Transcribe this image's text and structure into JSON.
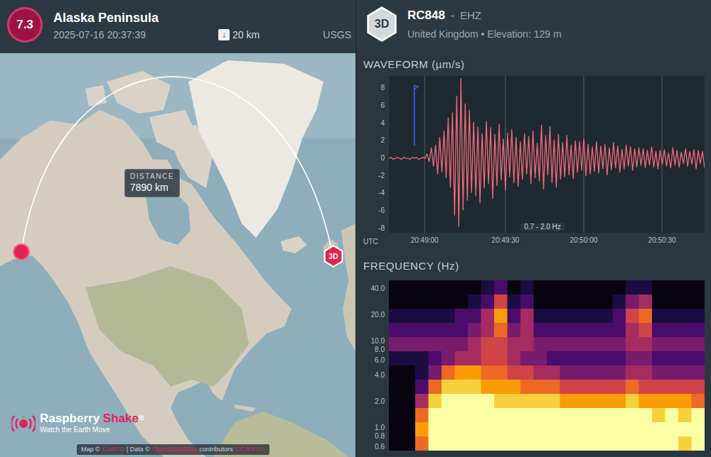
{
  "event": {
    "magnitude": "7.3",
    "region": "Alaska Peninsula",
    "time": "2025-07-16 20:37:39",
    "depth_icon": "↓",
    "depth": "20 km",
    "source": "USGS"
  },
  "map": {
    "distance_label": "DISTANCE",
    "distance": "7890 km",
    "station_marker": "3D",
    "attribution": [
      {
        "text": "Map ©",
        "kind": "text"
      },
      {
        "text": "CARTO",
        "kind": "link"
      },
      {
        "text": "| Data ©",
        "kind": "text"
      },
      {
        "text": "OpenStreetMap",
        "kind": "link"
      },
      {
        "text": "contributors",
        "kind": "text"
      },
      {
        "text": "CC-BY-SA",
        "kind": "link"
      }
    ]
  },
  "logo": {
    "name_1": "Raspberry",
    "name_2": "Shake",
    "mark": "®",
    "tagline": "Watch the Earth Move"
  },
  "station": {
    "badge": "3D",
    "code": "RC848",
    "separator": "-",
    "channel": "EHZ",
    "location": "United Kingdom • Elevation: 129 m"
  },
  "waveform": {
    "title": "WAVEFORM (µm/s)",
    "y_ticks": [
      "8",
      "6",
      "4",
      "2",
      "0",
      "-2",
      "-4",
      "-6",
      "-8"
    ],
    "x_ticks": [
      "20:49:00",
      "20:49:30",
      "20:50:00",
      "20:50:30"
    ],
    "axis_label": "UTC",
    "filter": "0.7 - 2.0 Hz",
    "marker_sample": 12,
    "values": [
      0,
      0.1,
      -0.1,
      0,
      0.1,
      0,
      -0.1,
      0.1,
      0,
      0,
      -0.1,
      0.1,
      0,
      0.1,
      -0.1,
      0,
      0.1,
      0,
      0.5,
      -0.4,
      1.2,
      -0.9,
      1.5,
      -1.8,
      2.4,
      -1.6,
      3.1,
      -2.2,
      4.6,
      -3.3,
      5.2,
      -6.5,
      7.1,
      -7.8,
      9.1,
      -5.9,
      6.2,
      -4.8,
      5.5,
      -3.9,
      4.1,
      -4.3,
      3.6,
      -5.1,
      2.8,
      -3.4,
      4.2,
      -2.9,
      3.5,
      -4.6,
      2.7,
      -3.1,
      3.9,
      -2.5,
      2.2,
      -3.6,
      2.9,
      -2.1,
      3.3,
      -2.8,
      2.4,
      -3.2,
      1.9,
      -2.4,
      2.8,
      -1.8,
      2.5,
      -2.9,
      3.1,
      -2.2,
      1.7,
      -2.6,
      3.8,
      -3.5,
      2.6,
      -1.9,
      3.6,
      -2.8,
      2.1,
      -3.3,
      2.7,
      -2.4,
      1.8,
      -2.1,
      2.6,
      -1.9,
      1.5,
      -2.3,
      2.0,
      -1.6,
      1.9,
      -1.4,
      2.2,
      -2.0,
      1.6,
      -1.8,
      1.3,
      -1.5,
      1.9,
      -1.7,
      1.4,
      -1.2,
      1.6,
      -1.9,
      1.2,
      -1.3,
      1.8,
      -1.1,
      1.4,
      -1.6,
      1.0,
      -1.2,
      1.5,
      -0.9,
      1.3,
      -1.4,
      1.1,
      -1.0,
      1.2,
      -0.8,
      1.1,
      -1.1,
      0.9,
      -0.8,
      1.3,
      -1.0,
      0.8,
      -1.2,
      0.9,
      -0.7,
      1.0,
      -0.9,
      0.6,
      -1.1,
      1.2,
      -0.8,
      0.9,
      -1.0,
      0.7,
      -0.6,
      1.1,
      -0.9,
      0.8,
      -0.7,
      1.0,
      -1.2,
      0.9,
      -0.6,
      0.8,
      -1.1
    ]
  },
  "spectrogram": {
    "title": "FREQUENCY (Hz)",
    "y_ticks": [
      "40.0",
      "20.0",
      "10.0",
      "8.0",
      "6.0",
      "4.0",
      "2.0",
      "1.0",
      "0.8",
      "0.6"
    ],
    "rows": [
      [
        0,
        0,
        0,
        0,
        0,
        0,
        0,
        1,
        2,
        0,
        1,
        0,
        0,
        0,
        0,
        0,
        0,
        0,
        1,
        1,
        0,
        0,
        0,
        0
      ],
      [
        0,
        0,
        0,
        0,
        0,
        0,
        1,
        2,
        5,
        1,
        2,
        0,
        0,
        0,
        0,
        0,
        0,
        1,
        3,
        4,
        0,
        0,
        0,
        0
      ],
      [
        1,
        1,
        1,
        1,
        1,
        2,
        2,
        4,
        7,
        2,
        4,
        1,
        1,
        1,
        1,
        1,
        1,
        2,
        5,
        6,
        1,
        1,
        1,
        1
      ],
      [
        2,
        2,
        2,
        2,
        2,
        2,
        3,
        4,
        6,
        3,
        4,
        2,
        2,
        2,
        2,
        2,
        2,
        2,
        4,
        5,
        2,
        2,
        2,
        2
      ],
      [
        3,
        3,
        3,
        3,
        3,
        3,
        4,
        5,
        5,
        4,
        4,
        3,
        3,
        3,
        3,
        3,
        3,
        3,
        4,
        4,
        3,
        3,
        3,
        3
      ],
      [
        1,
        1,
        1,
        2,
        3,
        4,
        4,
        5,
        5,
        4,
        3,
        3,
        2,
        2,
        2,
        2,
        2,
        2,
        3,
        3,
        2,
        2,
        2,
        2
      ],
      [
        0,
        0,
        1,
        3,
        6,
        7,
        7,
        6,
        6,
        5,
        5,
        4,
        4,
        3,
        3,
        3,
        3,
        3,
        4,
        4,
        3,
        3,
        3,
        3
      ],
      [
        0,
        0,
        2,
        6,
        8,
        8,
        8,
        7,
        7,
        7,
        6,
        6,
        6,
        5,
        5,
        5,
        5,
        5,
        6,
        5,
        5,
        5,
        5,
        5
      ],
      [
        0,
        0,
        4,
        8,
        9,
        9,
        9,
        9,
        8,
        8,
        8,
        8,
        8,
        7,
        7,
        7,
        7,
        7,
        8,
        7,
        7,
        7,
        7,
        6
      ],
      [
        0,
        0,
        6,
        9,
        9,
        9,
        9,
        9,
        9,
        9,
        9,
        9,
        9,
        9,
        9,
        9,
        9,
        9,
        9,
        9,
        8,
        9,
        8,
        9
      ],
      [
        0,
        0,
        7,
        9,
        9,
        9,
        9,
        9,
        9,
        9,
        9,
        9,
        9,
        9,
        9,
        9,
        9,
        9,
        9,
        9,
        9,
        9,
        9,
        9
      ],
      [
        0,
        0,
        6,
        9,
        9,
        9,
        9,
        9,
        9,
        9,
        9,
        9,
        9,
        9,
        9,
        9,
        9,
        9,
        9,
        9,
        9,
        9,
        8,
        9
      ]
    ]
  }
}
